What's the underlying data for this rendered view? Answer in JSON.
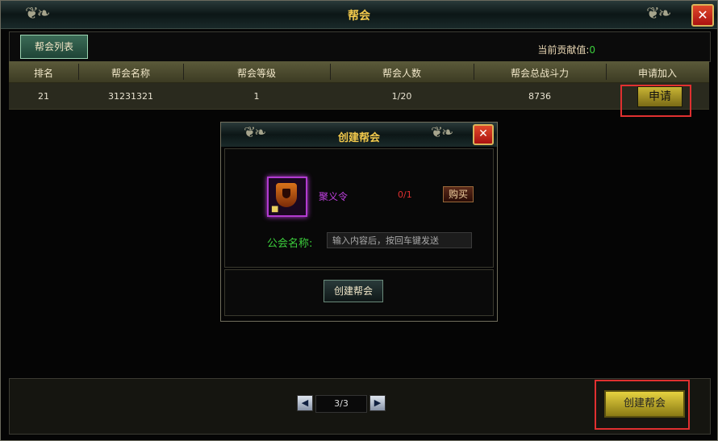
{
  "window": {
    "title": "帮会"
  },
  "tabs": [
    {
      "label": "帮会列表"
    }
  ],
  "contribution": {
    "label": "当前贡献值:",
    "value": "0"
  },
  "table": {
    "headers": [
      "排名",
      "帮会名称",
      "帮会等级",
      "帮会人数",
      "帮会总战斗力",
      "申请加入"
    ],
    "rows": [
      {
        "rank": "21",
        "name": "31231321",
        "level": "1",
        "members": "1/20",
        "power": "8736",
        "action": "申请"
      }
    ]
  },
  "pager": {
    "current": "3/3"
  },
  "footer": {
    "create_label": "创建帮会"
  },
  "dialog": {
    "title": "创建帮会",
    "item_name": "聚义令",
    "item_count": "0/1",
    "buy_label": "购买",
    "name_label": "公会名称:",
    "name_placeholder": "输入内容后，按回车键发送",
    "create_label": "创建帮会"
  },
  "icons": [
    "ornament-icon",
    "close-icon",
    "shield-item-icon",
    "lock-icon",
    "arrow-left-icon",
    "arrow-right-icon"
  ],
  "colors": {
    "title": "#f2c94c",
    "accent_green": "#3ccf3c",
    "highlight_red": "#e03030",
    "item_purple": "#c040e0"
  }
}
